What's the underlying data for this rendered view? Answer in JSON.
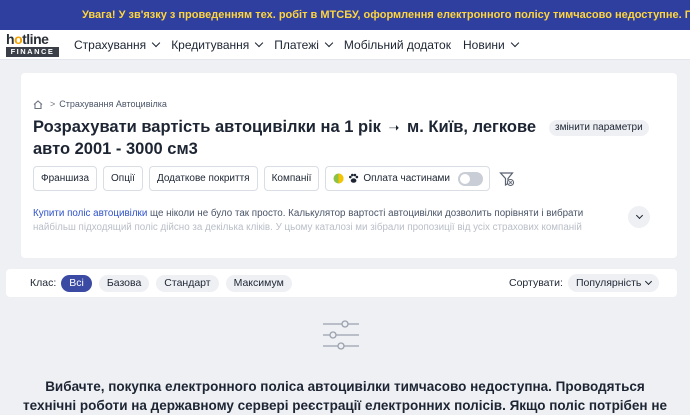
{
  "banner": {
    "text": "Увага! У зв'язку з проведенням тех. робіт в МТСБУ, оформлення електронного полісу тимчасово недоступне. Приносимо вибачення"
  },
  "logo": {
    "top": "hotline",
    "bottom": "FINANCE"
  },
  "nav": {
    "items": [
      {
        "label": "Страхування",
        "has_dropdown": true
      },
      {
        "label": "Кредитування",
        "has_dropdown": true
      },
      {
        "label": "Платежі",
        "has_dropdown": true
      },
      {
        "label": "Мобільний додаток",
        "has_dropdown": false
      },
      {
        "label": "Новини",
        "has_dropdown": true
      }
    ]
  },
  "breadcrumb": {
    "sep": ">",
    "item": "Страхування Автоцивілка"
  },
  "page": {
    "title_part1": "Розрахувати вартість автоцивілки на 1 рік",
    "title_arrow": "➝",
    "title_part2": "м. Київ, легкове авто 2001 - 3000 см3",
    "change_params": "змінити параметри"
  },
  "filters": {
    "buttons": [
      "Франшиза",
      "Опції",
      "Додаткове покриття",
      "Компанії"
    ],
    "installments_label": "Оплата частинами",
    "installments_on": false
  },
  "description": {
    "link1": "Купити поліс автоцивілки",
    "line1_rest": " ще ніколи не було так просто. Калькулятор вартості автоцивілки дозволить порівняти і вибрати",
    "line2": "найбільш підходящий поліс дійсно за декілька кліків. У цьому каталозі ми зібрали пропозиції від усіх страхових компаній"
  },
  "classbar": {
    "label": "Клас:",
    "chips": [
      "Всі",
      "Базова",
      "Стандарт",
      "Максимум"
    ],
    "active_index": 0,
    "sort_label": "Сортувати:",
    "sort_value": "Популярність"
  },
  "message": {
    "line1": "Вибачте, покупка електронного поліса автоцивілки тимчасово недоступна. Проводяться",
    "line2": "технічні роботи на державному сервері реєстрації електронних полісів. Якщо поліс потрібен не"
  },
  "colors": {
    "banner_bg": "#2e3f9f",
    "banner_text": "#ffd53d",
    "accent": "#3b4aa3",
    "link": "#2e52c9"
  }
}
